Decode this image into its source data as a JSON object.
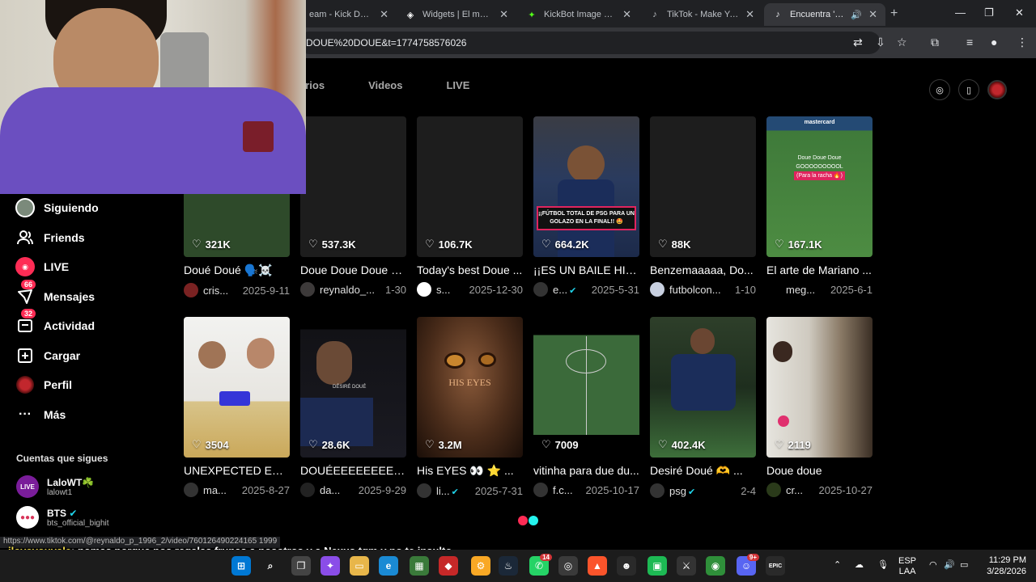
{
  "browser": {
    "tabs": [
      {
        "label": "eam - Kick Dashb",
        "icon": "kick-icon"
      },
      {
        "label": "Widgets | El mejor sc",
        "icon": "widgets-icon"
      },
      {
        "label": "KickBot Image Gene",
        "icon": "kickbot-icon"
      },
      {
        "label": "TikTok - Make Your D",
        "icon": "tiktok-icon"
      },
      {
        "label": "Encuentra 'DOUÉ",
        "icon": "tiktok-icon",
        "active": true
      }
    ],
    "url": "DOUE%20DOUE&t=1774758576026"
  },
  "search_tabs": [
    "arios",
    "Videos",
    "LIVE"
  ],
  "sidebar": {
    "items": [
      {
        "label": "Siguiendo",
        "icon": "following-icon"
      },
      {
        "label": "Friends",
        "icon": "friends-icon"
      },
      {
        "label": "LIVE",
        "icon": "live-icon"
      },
      {
        "label": "Mensajes",
        "icon": "messages-icon",
        "badge": "66"
      },
      {
        "label": "Actividad",
        "icon": "activity-icon",
        "badge": "32"
      },
      {
        "label": "Cargar",
        "icon": "upload-icon"
      },
      {
        "label": "Perfil",
        "icon": "profile-icon"
      },
      {
        "label": "Más",
        "icon": "more-icon"
      }
    ],
    "following_title": "Cuentas que sigues",
    "following": [
      {
        "name": "LaloWT☘️",
        "handle": "lalowt1"
      },
      {
        "name": "BTS",
        "handle": "bts_official_bighit",
        "verified": true
      }
    ]
  },
  "videos": [
    {
      "likes": "321K",
      "title": "Doué Doué 🗣️☠️",
      "user": "cris...",
      "date": "2025-9-11"
    },
    {
      "likes": "537.3K",
      "title": "Doue Doue Doue D...",
      "user": "reynaldo_...",
      "date": "1-30"
    },
    {
      "likes": "106.7K",
      "title": "Today's best Doue ...",
      "user": "s...",
      "date": "2025-12-30"
    },
    {
      "likes": "664.2K",
      "title": "¡¡ES UN BAILE HIST...",
      "user": "e...",
      "date": "2025-5-31",
      "verified": true
    },
    {
      "likes": "88K",
      "title": "Benzemaaaaa, Do...",
      "user": "futbolcon...",
      "date": "1-10"
    },
    {
      "likes": "167.1K",
      "title": "El arte de Mariano ...",
      "user": "meg...",
      "date": "2025-6-1"
    },
    {
      "likes": "3504",
      "title": "UNEXPECTED EDIT",
      "user": "ma...",
      "date": "2025-8-27"
    },
    {
      "likes": "28.6K",
      "title": "DOUÉEEEEEEEEEEE...",
      "user": "da...",
      "date": "2025-9-29"
    },
    {
      "likes": "3.2M",
      "title": "His EYES 👀 ⭐ ...",
      "user": "li...",
      "date": "2025-7-31",
      "verified": true
    },
    {
      "likes": "7009",
      "title": "vitinha para due du...",
      "user": "f.c...",
      "date": "2025-10-17"
    },
    {
      "likes": "402.4K",
      "title": "Desiré Doué 🫶 ...",
      "user": "psg",
      "date": "2-4",
      "verified": true
    },
    {
      "likes": "2119",
      "title": "Doue doue",
      "user": "cr...",
      "date": "2025-10-27"
    }
  ],
  "thumb_text": {
    "v4": "¡¡FÚTBOL TOTAL DE PSG PARA UN GOLAZO EN LA FINAL!! 🤩",
    "v6_line1": "Doue Doue Doue",
    "v6_line2": "GOOOOOOOOOL",
    "v6_line3": "(Para la racha 🔥)",
    "v6_brand": "mastercard",
    "v8_text": "DÉSIRÉ DOUÉ",
    "v9_text": "HIS EYES"
  },
  "status_url": "https://www.tiktok.com/@reynaldo_p_1996_2/video/760126490224165 1999",
  "chat": {
    "user": "iloveyouvale",
    "message": ": nomas porque nos regalas frunas a nosotros y a Nexus tqm y no te insulto"
  },
  "system": {
    "lang": "ESP",
    "lang2": "LAA",
    "time": "11:29 PM",
    "date": "3/28/2026"
  }
}
